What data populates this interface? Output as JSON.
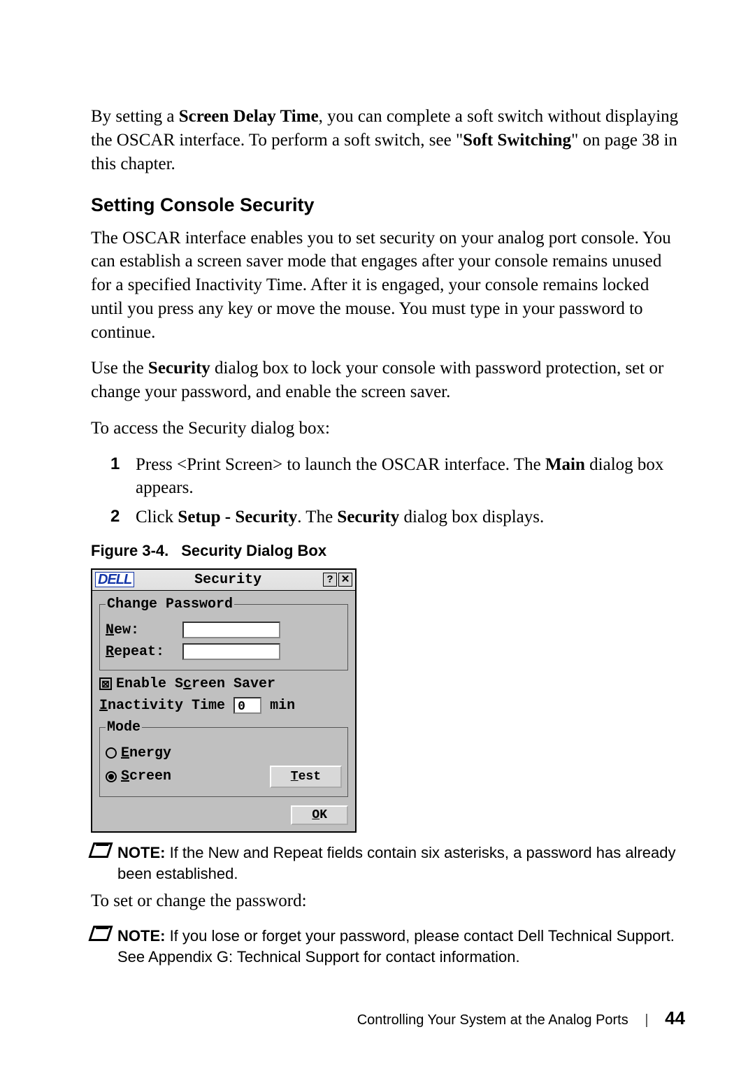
{
  "intro": {
    "p1_a": "By setting a ",
    "p1_b": "Screen Delay Time",
    "p1_c": ", you can complete a soft switch without displaying the OSCAR interface. To perform a soft switch, see \"",
    "p1_d": "Soft Switching",
    "p1_e": "\" on page 38 in this chapter."
  },
  "section_title": "Setting Console Security",
  "body": {
    "p2": "The OSCAR interface enables you to set security on your analog port console. You can establish a screen saver mode that engages after your console remains unused for a specified Inactivity Time. After it is engaged, your console remains locked until you press any key or move the mouse. You must type in your password to continue.",
    "p3_a": "Use the ",
    "p3_b": "Security",
    "p3_c": " dialog box to lock your console with password protection, set or change your password, and enable the screen saver.",
    "p4": "To access the Security dialog box:"
  },
  "steps": {
    "s1_a": "Press <Print Screen> to launch the OSCAR interface. The ",
    "s1_b": "Main",
    "s1_c": " dialog box appears.",
    "s2_a": "Click ",
    "s2_b": "Setup - Security",
    "s2_c": ". The ",
    "s2_d": "Security",
    "s2_e": " dialog box displays.",
    "n1": "1",
    "n2": "2"
  },
  "figure": {
    "num": "Figure 3-4.",
    "title": "Security Dialog Box"
  },
  "dialog": {
    "brand": "DELL",
    "title": "Security",
    "help_glyph": "?",
    "close_glyph": "✕",
    "group_change": "Change Password",
    "new_label_pre": "N",
    "new_label_post": "ew:",
    "repeat_label_pre": "R",
    "repeat_label_post": "epeat:",
    "enable_ss_pre": "Enable S",
    "enable_ss_accel": "c",
    "enable_ss_post": "reen Saver",
    "enable_ss_checked": "⊠",
    "inactivity_pre": "I",
    "inactivity_post": "nactivity Time",
    "inactivity_value": "0",
    "inactivity_unit": "min",
    "mode_legend": "Mode",
    "energy_pre": "E",
    "energy_post": "nergy",
    "screen_pre": "S",
    "screen_post": "creen",
    "test_pre": "T",
    "test_post": "est",
    "ok_pre": "O",
    "ok_post": "K"
  },
  "notes": {
    "label": "NOTE:",
    "n1": " If the New and Repeat fields contain six asterisks, a password has already been established.",
    "between": "To set or change the password:",
    "n2": " If you lose or forget your password, please contact Dell Technical Support. See Appendix G: Technical Support for contact information."
  },
  "footer": {
    "chapter": "Controlling Your System at the Analog Ports",
    "page": "44",
    "sep": "|"
  }
}
